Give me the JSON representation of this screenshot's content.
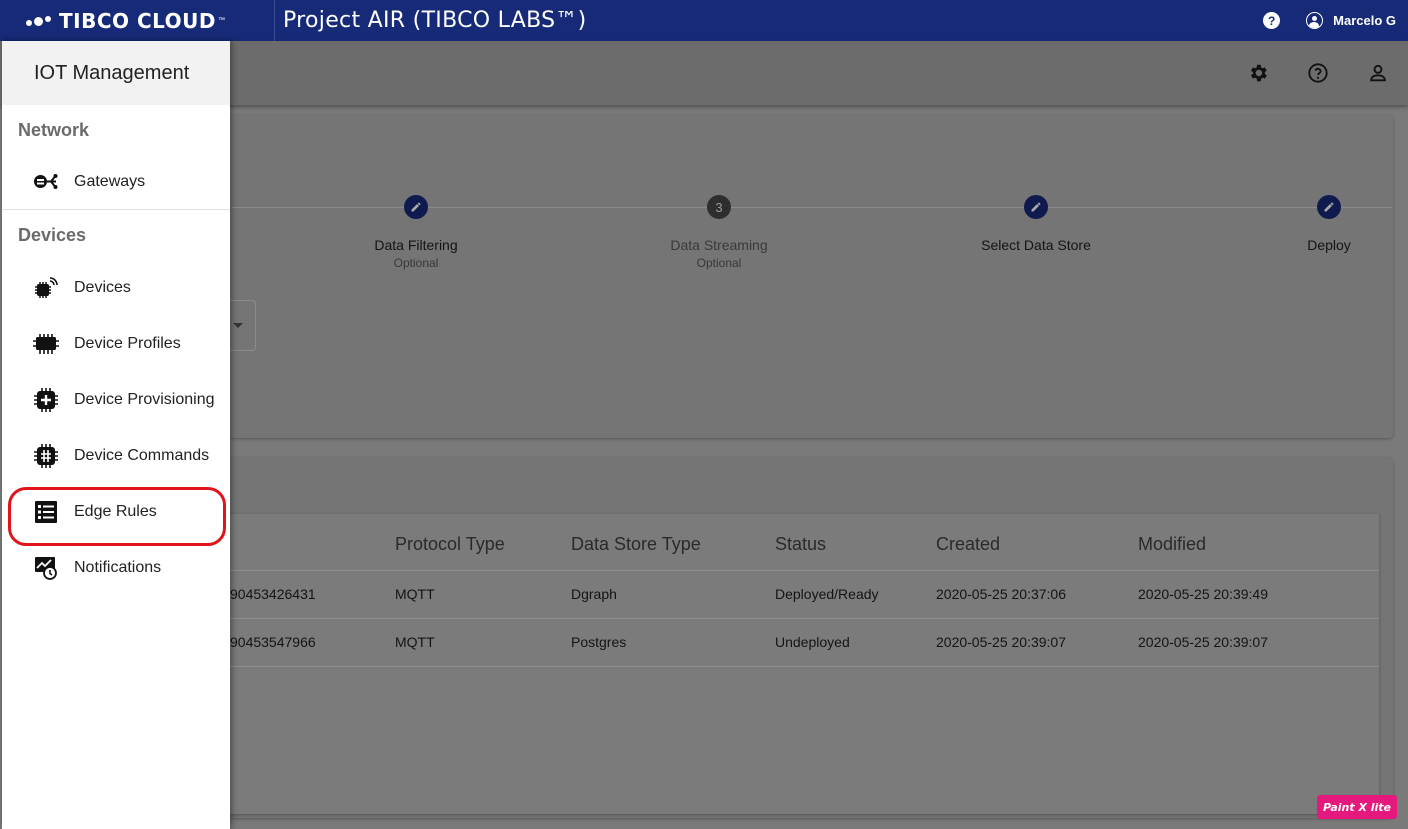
{
  "topbar": {
    "brand": "TIBCO CLOUD",
    "brand_tm": "™",
    "project_title": "Project AIR (TIBCO LABS™)",
    "help_label": "?",
    "user_name": "Marcelo G"
  },
  "header_icons": [
    "settings-icon",
    "help-circle-icon",
    "account-icon"
  ],
  "stepper": {
    "steps": [
      {
        "label": "Data Filtering",
        "sub": "Optional",
        "marker": "edit"
      },
      {
        "label": "Data Streaming",
        "sub": "Optional",
        "marker": "3"
      },
      {
        "label": "Select Data Store",
        "sub": "",
        "marker": "edit"
      },
      {
        "label": "Deploy",
        "sub": "",
        "marker": "edit"
      }
    ]
  },
  "table": {
    "columns": [
      "Protocol Type",
      "Data Store Type",
      "Status",
      "Created",
      "Modified"
    ],
    "rows": [
      {
        "id_fragment": "90453426431",
        "protocol": "MQTT",
        "store": "Dgraph",
        "status": "Deployed/Ready",
        "created": "2020-05-25 20:37:06",
        "modified": "2020-05-25 20:39:49"
      },
      {
        "id_fragment": "90453547966",
        "protocol": "MQTT",
        "store": "Postgres",
        "status": "Undeployed",
        "created": "2020-05-25 20:39:07",
        "modified": "2020-05-25 20:39:07"
      }
    ]
  },
  "drawer": {
    "title": "IOT Management",
    "sections": [
      {
        "title": "Network",
        "items": [
          {
            "label": "Gateways",
            "icon": "gateway-icon"
          }
        ]
      },
      {
        "title": "Devices",
        "items": [
          {
            "label": "Devices",
            "icon": "device-icon"
          },
          {
            "label": "Device Profiles",
            "icon": "device-profile-icon"
          },
          {
            "label": "Device Provisioning",
            "icon": "device-provisioning-icon"
          },
          {
            "label": "Device Commands",
            "icon": "device-commands-icon"
          },
          {
            "label": "Edge Rules",
            "icon": "edge-rules-icon",
            "highlighted": true
          },
          {
            "label": "Notifications",
            "icon": "notifications-icon"
          }
        ]
      }
    ]
  },
  "watermark": "Paint X lite",
  "colors": {
    "topbar": "#162a78",
    "highlight": "#e1141a",
    "watermark": "#e5197d"
  }
}
